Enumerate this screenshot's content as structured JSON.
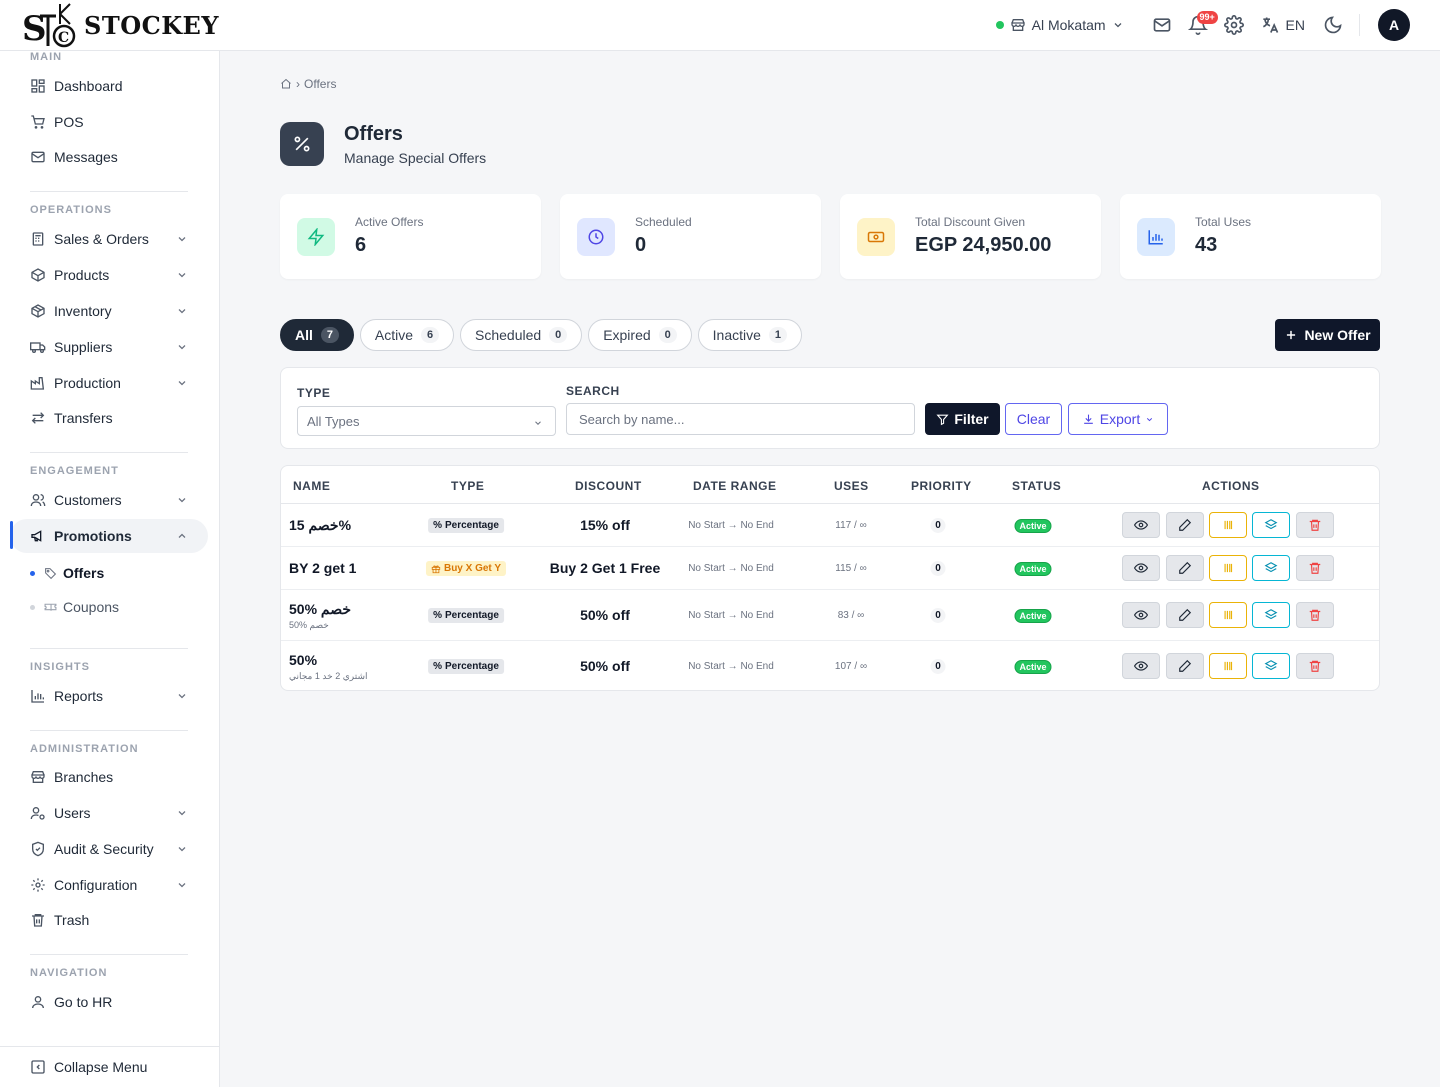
{
  "app": {
    "logo_text": "STOCKEY"
  },
  "topbar": {
    "branch": "Al Mokatam",
    "notifications_badge": "99+",
    "language": "EN",
    "avatar_initial": "A"
  },
  "sidebar": {
    "sections": {
      "main": "MAIN",
      "operations": "OPERATIONS",
      "engagement": "ENGAGEMENT",
      "insights": "INSIGHTS",
      "administration": "ADMINISTRATION",
      "navigation": "NAVIGATION"
    },
    "items": {
      "dashboard": "Dashboard",
      "pos": "POS",
      "messages": "Messages",
      "sales_orders": "Sales & Orders",
      "products": "Products",
      "inventory": "Inventory",
      "suppliers": "Suppliers",
      "production": "Production",
      "transfers": "Transfers",
      "customers": "Customers",
      "promotions": "Promotions",
      "offers": "Offers",
      "coupons": "Coupons",
      "reports": "Reports",
      "branches": "Branches",
      "users": "Users",
      "audit_security": "Audit & Security",
      "configuration": "Configuration",
      "trash": "Trash",
      "go_to_hr": "Go to HR"
    },
    "collapse": "Collapse Menu"
  },
  "breadcrumb": {
    "current": "Offers"
  },
  "page": {
    "title": "Offers",
    "subtitle": "Manage Special Offers"
  },
  "stats": [
    {
      "label": "Active Offers",
      "value": "6",
      "color": "#10b981"
    },
    {
      "label": "Scheduled",
      "value": "0",
      "color": "#4f46e5"
    },
    {
      "label": "Total Discount Given",
      "value": "EGP 24,950.00",
      "color": "#d97706"
    },
    {
      "label": "Total Uses",
      "value": "43",
      "color": "#2563eb"
    }
  ],
  "tabs": [
    {
      "label": "All",
      "count": "7"
    },
    {
      "label": "Active",
      "count": "6"
    },
    {
      "label": "Scheduled",
      "count": "0"
    },
    {
      "label": "Expired",
      "count": "0"
    },
    {
      "label": "Inactive",
      "count": "1"
    }
  ],
  "new_offer_label": "New Offer",
  "filters": {
    "type_label": "TYPE",
    "type_value": "All Types",
    "search_label": "SEARCH",
    "search_placeholder": "Search by name...",
    "filter_btn": "Filter",
    "clear_btn": "Clear",
    "export_btn": "Export"
  },
  "table": {
    "headers": {
      "name": "NAME",
      "type": "TYPE",
      "discount": "DISCOUNT",
      "date_range": "DATE RANGE",
      "uses": "USES",
      "priority": "PRIORITY",
      "status": "STATUS",
      "actions": "ACTIONS"
    },
    "rows": [
      {
        "name": "15 خصم%",
        "subname": "",
        "type": "Percentage",
        "discount": "15% off",
        "date_range": "No Start → No End",
        "uses": "117 / ∞",
        "priority": "0",
        "status": "Active"
      },
      {
        "name": "BY 2 get 1",
        "subname": "",
        "type": "Buy X Get Y",
        "discount": "Buy 2 Get 1 Free",
        "date_range": "No Start → No End",
        "uses": "115 / ∞",
        "priority": "0",
        "status": "Active"
      },
      {
        "name": "50% خصم",
        "subname": "50% خصم",
        "type": "Percentage",
        "discount": "50% off",
        "date_range": "No Start → No End",
        "uses": "83 / ∞",
        "priority": "0",
        "status": "Active"
      },
      {
        "name": "50%",
        "subname": "اشتري 2 خد 1 مجاني",
        "type": "Percentage",
        "discount": "50% off",
        "date_range": "No Start → No End",
        "uses": "107 / ∞",
        "priority": "0",
        "status": "Active"
      }
    ]
  }
}
